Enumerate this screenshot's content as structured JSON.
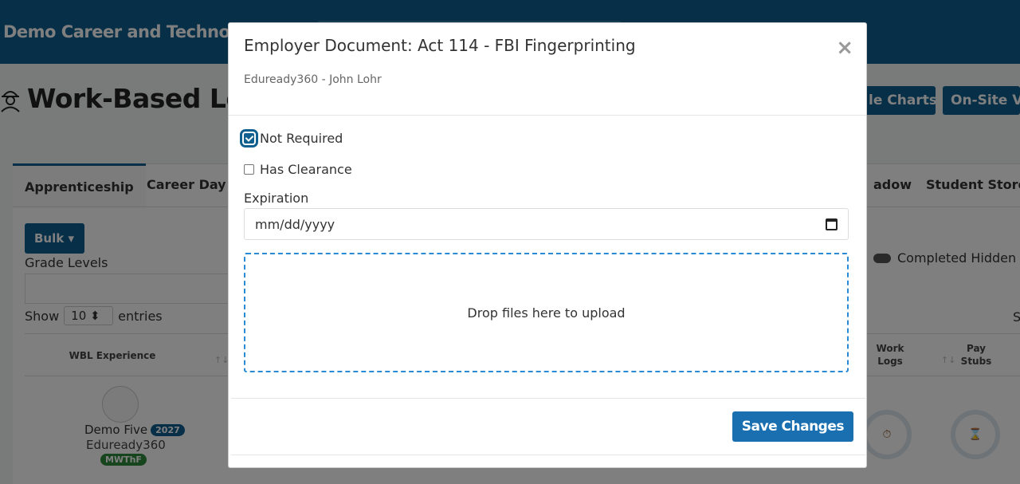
{
  "header": {
    "site_title": "Demo Career and Technolog"
  },
  "page": {
    "title": "Work-Based Lea",
    "buttons": [
      "le Charts",
      "On-Site Vis"
    ]
  },
  "tabs": [
    {
      "label": "Apprenticeship",
      "active": true
    },
    {
      "label": "Career Day"
    },
    {
      "label": "adow"
    },
    {
      "label": "Student Store ("
    }
  ],
  "controls": {
    "bulk_label": "Bulk ▾",
    "grade_levels_label": "Grade Levels",
    "show_label": "Show",
    "entries_value": "10 ⬍",
    "entries_label": "entries",
    "completed_hidden_label": "Completed Hidden (",
    "search_partial": "S"
  },
  "table": {
    "columns": [
      {
        "label": "WBL Experience"
      },
      {
        "label": "Work Logs"
      },
      {
        "label": "Pay Stubs"
      }
    ],
    "rows": [
      {
        "name": "Demo Five",
        "year": "2027",
        "company": "Eduready360",
        "days": "MWThF",
        "work_logs_icon": "⏱",
        "pay_stubs_icon": "⌛"
      }
    ]
  },
  "modal": {
    "title": "Employer Document: Act 114 - FBI Fingerprinting",
    "subtitle": "Eduready360 - John Lohr",
    "close_glyph": "×",
    "not_required_label": "Not Required",
    "not_required_checked": true,
    "has_clearance_label": "Has Clearance",
    "has_clearance_checked": false,
    "expiration_label": "Expiration",
    "expiration_placeholder": "mm/dd/yyyy",
    "dropzone_text": "Drop files here to upload",
    "save_label": "Save Changes"
  },
  "colors": {
    "brand": "#0f5f8f",
    "save_button": "#1a6fb0",
    "dropzone_border": "#2a8ad4",
    "badge_green": "#2e8b3d"
  }
}
